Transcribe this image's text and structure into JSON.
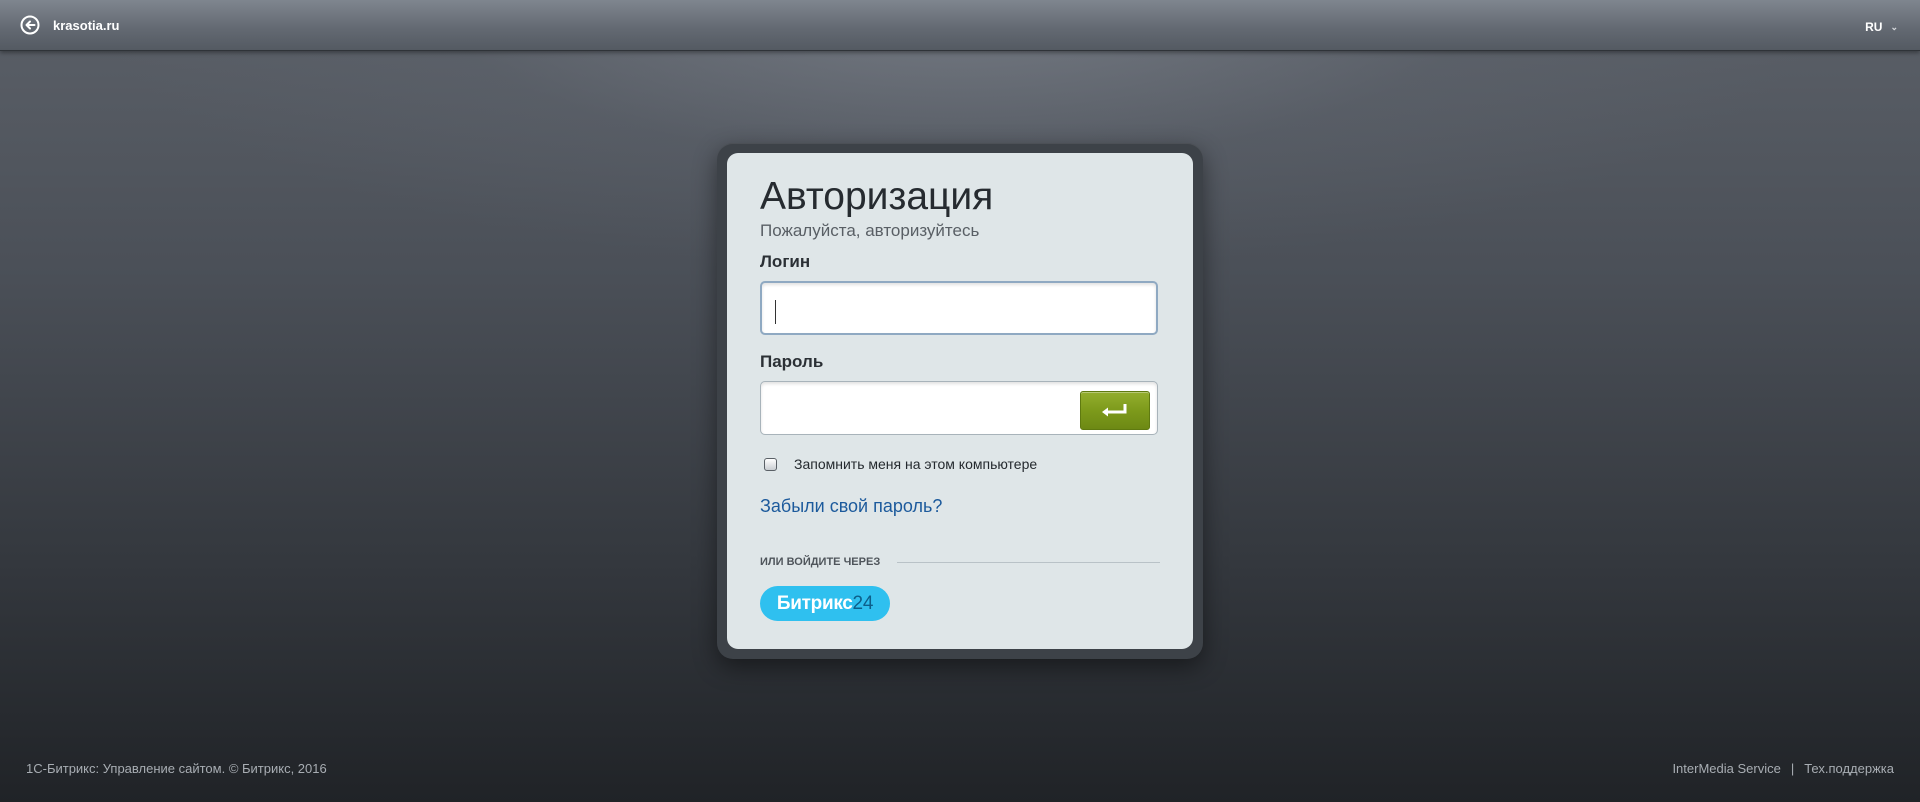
{
  "header": {
    "site_name": "krasotia.ru",
    "language": "RU"
  },
  "login_form": {
    "title": "Авторизация",
    "subtitle": "Пожалуйста, авторизуйтесь",
    "login_label": "Логин",
    "login_value": "",
    "password_label": "Пароль",
    "password_value": "",
    "remember_label": "Запомнить меня на этом компьютере",
    "remember_checked": false,
    "forgot_link": "Забыли свой пароль?",
    "or_label": "ИЛИ ВОЙДИТЕ ЧЕРЕЗ",
    "bitrix24_text": "Битрикс",
    "bitrix24_number": "24"
  },
  "footer": {
    "copyright": "1С-Битрикс: Управление сайтом. © Битрикс, 2016",
    "link_intermedia": "InterMedia Service",
    "separator": "|",
    "link_support": "Тех.поддержка"
  },
  "colors": {
    "submit_green": "#7d9a1b",
    "bitrix24_blue": "#2fc0ef",
    "link_blue": "#1c5a9c"
  },
  "icons": {
    "back": "back-arrow-circle-icon",
    "submit": "enter-arrow-icon",
    "lang": "chevron-down-icon"
  }
}
